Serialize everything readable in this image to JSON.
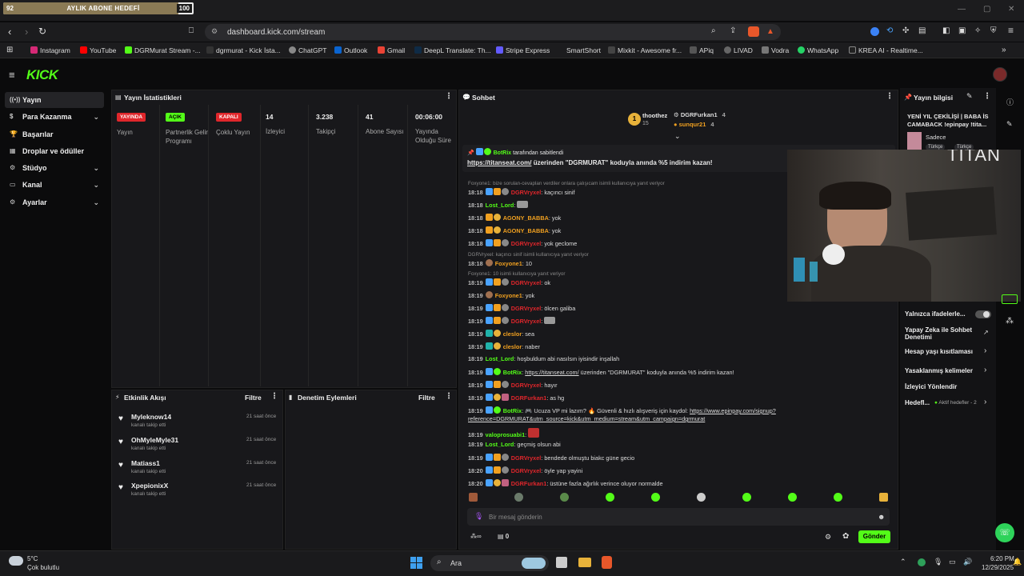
{
  "browser": {
    "goal": {
      "current": "92",
      "title": "AYLIK ABONE HEDEFİ",
      "target": "100",
      "progress": 0.92
    },
    "url": "dashboard.kick.com/stream",
    "bookmarks": [
      "Instagram",
      "YouTube",
      "DGRMurat Stream -...",
      "dgrmurat - Kick İsta...",
      "ChatGPT",
      "Outlook",
      "Gmail",
      "DeepL Translate: Th...",
      "Stripe Express",
      "SmartShort",
      "Mixkit - Awesome fr...",
      "APiq",
      "LIVAD",
      "Vodra",
      "WhatsApp",
      "KREA AI - Realtime..."
    ]
  },
  "sidebar": {
    "items": [
      {
        "label": "Yayın",
        "icon": "broadcast-icon",
        "active": true
      },
      {
        "label": "Para Kazanma",
        "icon": "dollar-icon",
        "chevron": true
      },
      {
        "label": "Başarılar",
        "icon": "trophy-icon"
      },
      {
        "label": "Droplar ve ödüller",
        "icon": "gift-icon"
      },
      {
        "label": "Stüdyo",
        "icon": "studio-icon",
        "chevron": true
      },
      {
        "label": "Kanal",
        "icon": "channel-icon",
        "chevron": true
      },
      {
        "label": "Ayarlar",
        "icon": "gear-icon",
        "chevron": true
      }
    ]
  },
  "stats": {
    "title": "Yayın İstatistikleri",
    "items": [
      {
        "badge": "YAYINDA",
        "badge_color": "#e0262b",
        "label": "Yayın"
      },
      {
        "badge": "AÇIK",
        "badge_color": "#53fc18",
        "label": "Partnerlik Gelir Programı"
      },
      {
        "badge": "KAPALI",
        "badge_color": "#e0262b",
        "label": "Çoklu Yayın"
      },
      {
        "value": "14",
        "label": "İzleyici"
      },
      {
        "value": "3.238",
        "label": "Takipçi"
      },
      {
        "value": "41",
        "label": "Abone Sayısı"
      },
      {
        "value": "00:06:00",
        "label": "Yayında Olduğu Süre"
      }
    ]
  },
  "activity": {
    "title": "Etkinlik Akışı",
    "filter": "Filtre",
    "items": [
      {
        "name": "Myleknow14",
        "sub": "kanalı takip etti",
        "time": "21 saat önce"
      },
      {
        "name": "OhMyleMyle31",
        "sub": "kanalı takip etti",
        "time": "21 saat önce"
      },
      {
        "name": "Matiass1",
        "sub": "kanalı takip etti",
        "time": "21 saat önce"
      },
      {
        "name": "XpepionixX",
        "sub": "kanalı takip etti",
        "time": "21 saat önce"
      }
    ]
  },
  "moderation": {
    "title": "Denetim Eylemleri",
    "filter": "Filtre"
  },
  "chat": {
    "title": "Sohbet",
    "top": [
      {
        "name": "thoothez",
        "count": "15"
      },
      {
        "name": "DGRFurkan1",
        "count": "4"
      },
      {
        "name": "sunqur21",
        "count": "4"
      }
    ],
    "pinned": {
      "by": "BotRix",
      "by_suffix": "tarafından sabitlendi",
      "link": "https://titanseat.com/",
      "text": "üzerinden \"DGRMURAT\" koduyla anında %5 indirim kazan!"
    },
    "messages": [
      {
        "reply": "Foxyone1: bize sorulan-cevaplan verdiler onlara çalışıcam isimli kullanıcıya yanıt veriyor"
      },
      {
        "time": "18:18",
        "user": "DGRVryxel",
        "color": "#e0262b",
        "text": ": kaçıncı sinif"
      },
      {
        "time": "18:18",
        "user": "Lost_Lord",
        "color": "#53fc18",
        "text": ":"
      },
      {
        "time": "18:18",
        "user": "AGONY_BABBA",
        "color": "#f0a020",
        "text": ": yok"
      },
      {
        "time": "18:18",
        "user": "AGONY_BABBA",
        "color": "#f0a020",
        "text": ": yok"
      },
      {
        "time": "18:18",
        "user": "DGRVryxel",
        "color": "#e0262b",
        "text": ": yok geclome"
      },
      {
        "reply": "DGRVryxel: kaçıncı sinif isimli kullanıcıya yanıt veriyor"
      },
      {
        "time": "18:18",
        "user": "Foxyone1",
        "color": "#f0a020",
        "text": ": 10"
      },
      {
        "reply": "Foxyone1: 10 isimli kullanıcıya yanıt veriyor"
      },
      {
        "time": "18:19",
        "user": "DGRVryxel",
        "color": "#e0262b",
        "text": ": ok"
      },
      {
        "time": "18:19",
        "user": "Foxyone1",
        "color": "#f0a020",
        "text": ": yok"
      },
      {
        "time": "18:19",
        "user": "DGRVryxel",
        "color": "#e0262b",
        "text": ": ölcen galiba"
      },
      {
        "time": "18:19",
        "user": "DGRVryxel",
        "color": "#e0262b",
        "text": ":"
      },
      {
        "time": "18:19",
        "user": "cleslor",
        "color": "#f0a020",
        "text": ": sea"
      },
      {
        "time": "18:19",
        "user": "cleslor",
        "color": "#f0a020",
        "text": ": naber"
      },
      {
        "time": "18:19",
        "user": "Lost_Lord",
        "color": "#53fc18",
        "text": ": hoşbuldum abi nasılsın iyisindir inşallah"
      },
      {
        "time": "18:19",
        "user": "BotRix",
        "color": "#53fc18",
        "link": "https://titanseat.com/",
        "text": " üzerinden \"DGRMURAT\" koduyla anında %5 indirim kazan!"
      },
      {
        "time": "18:19",
        "user": "DGRVryxel",
        "color": "#e0262b",
        "text": ": hayır"
      },
      {
        "time": "18:19",
        "user": "DGRFurkan1",
        "color": "#e0262b",
        "text": ": as hg"
      },
      {
        "time": "18:19",
        "user": "BotRix",
        "color": "#53fc18",
        "text": ": 🎮 Ucuza VP mi lazım? 🔥 Güvenli & hızlı alışveriş için kaydol: ",
        "link": "https://www.epinpay.com/signup?",
        "link2": "reference=DGRMURAT&utm_source=kick&utm_medium=stream&utm_campaign=dgrmurat"
      },
      {
        "time": "18:19",
        "user": "valoprosuabi1",
        "color": "#53fc18",
        "text": ":"
      },
      {
        "time": "18:19",
        "user": "Lost_Lord",
        "color": "#53fc18",
        "text": ": geçmiş olsun abi"
      },
      {
        "time": "18:19",
        "user": "DGRVryxel",
        "color": "#e0262b",
        "text": ": bendede olmuştu biakc güne gecio"
      },
      {
        "time": "18:20",
        "user": "DGRVryxel",
        "color": "#e0262b",
        "text": ": öyle yap yayini"
      },
      {
        "time": "18:20",
        "user": "DGRFurkan1",
        "color": "#e0262b",
        "text": ": üstüne fazla ağırlık verince oluyor normalde"
      }
    ],
    "input_placeholder": "Bir mesaj gönderin",
    "send": "Gönder",
    "points": "0",
    "infinity": "∞"
  },
  "stream_info": {
    "title": "Yayın bilgisi",
    "stream_title": "YENİ YIL ÇEKİLİŞİ | BABA İS CAMABACK !epinpay !tita...",
    "tags": [
      "Türkçe",
      "Türkçe"
    ],
    "sadece": "Sadece",
    "cam_text": "TITAN",
    "items": [
      "Yalnızca ifadelerle...",
      "Yapay Zeka ile Sohbet Denetimi",
      "Hesap yaşı kısıtlaması",
      "Yasaklanmış kelimeler",
      "İzleyici Yönlendir",
      "Hedefl...",
      "Aktif hedefler - 2"
    ]
  },
  "taskbar": {
    "temp": "5°C",
    "weather": "Çok bulutlu",
    "search": "Ara",
    "time": "6:20 PM",
    "date": "12/29/2025"
  }
}
